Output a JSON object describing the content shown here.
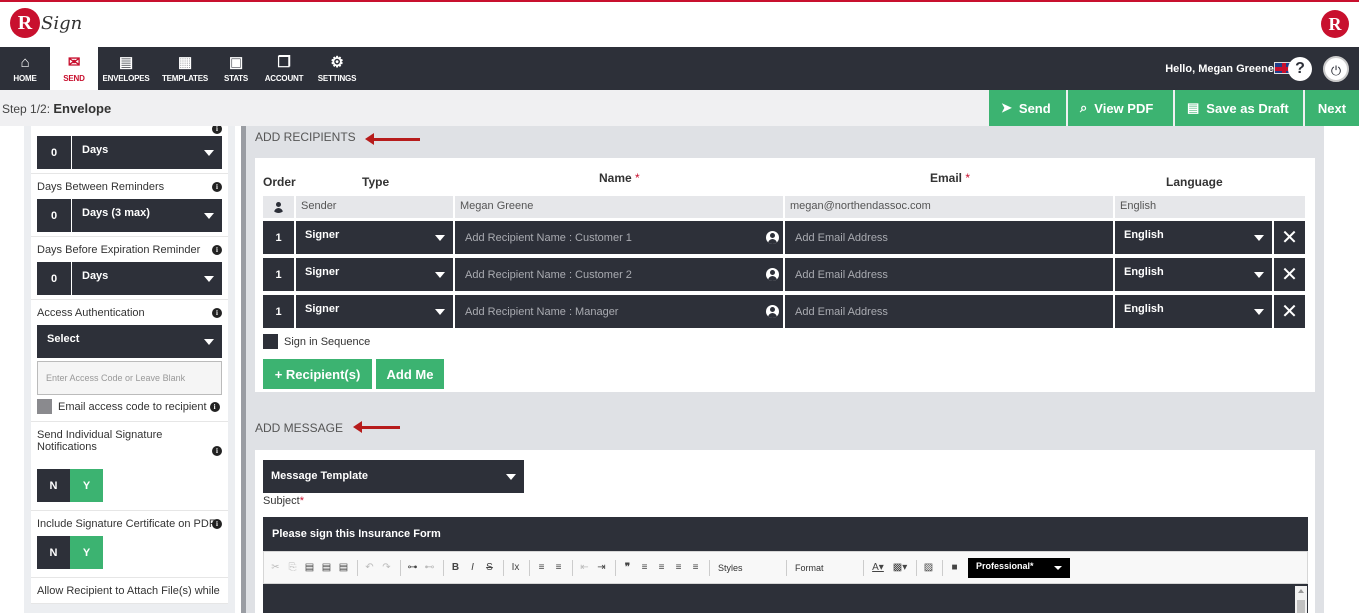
{
  "brand": {
    "logo_letter": "R",
    "logo_word": "Sign",
    "right_logo_letter": "R"
  },
  "nav": {
    "items": [
      {
        "label": "HOME",
        "icon": "home-icon"
      },
      {
        "label": "SEND",
        "icon": "envelope-icon"
      },
      {
        "label": "ENVELOPES",
        "icon": "inbox-icon"
      },
      {
        "label": "TEMPLATES",
        "icon": "document-icon"
      },
      {
        "label": "STATS",
        "icon": "briefcase-icon"
      },
      {
        "label": "ACCOUNT",
        "icon": "files-icon"
      },
      {
        "label": "SETTINGS",
        "icon": "gear-icon"
      }
    ],
    "active": "SEND",
    "greeting": "Hello, Megan Greene",
    "help_glyph": "?",
    "power_glyph": "⏻"
  },
  "step": {
    "prefix": "Step 1/2:",
    "name": "Envelope"
  },
  "actions": {
    "send": "Send",
    "view_pdf": "View PDF",
    "save_draft": "Save as Draft",
    "next": "Next"
  },
  "sidebar": {
    "top_dd": {
      "num": "0",
      "value": "Days"
    },
    "reminders": {
      "label": "Days Between Reminders",
      "num": "0",
      "value": "Days (3 max)"
    },
    "expiration": {
      "label": "Days Before Expiration Reminder",
      "num": "0",
      "value": "Days"
    },
    "access": {
      "label": "Access Authentication",
      "value": "Select",
      "placeholder": "Enter Access Code or Leave Blank",
      "email_code": "Email access code to recipient"
    },
    "individual": {
      "label": "Send Individual Signature Notifications",
      "n": "N",
      "y": "Y"
    },
    "certificate": {
      "label": "Include Signature Certificate on PDF",
      "n": "N",
      "y": "Y"
    },
    "attach": {
      "label": "Allow Recipient to Attach File(s) while"
    }
  },
  "recipients": {
    "section_title": "ADD RECIPIENTS",
    "headers": {
      "order": "Order",
      "type": "Type",
      "name": "Name",
      "email": "Email",
      "language": "Language",
      "required": "*"
    },
    "sender": {
      "type": "Sender",
      "name": "Megan Greene",
      "email": "megan@northendassoc.com",
      "language": "English"
    },
    "rows": [
      {
        "order": "1",
        "type": "Signer",
        "name_placeholder": "Add Recipient Name : Customer 1",
        "email_placeholder": "Add Email Address",
        "language": "English"
      },
      {
        "order": "1",
        "type": "Signer",
        "name_placeholder": "Add Recipient Name : Customer 2",
        "email_placeholder": "Add Email Address",
        "language": "English"
      },
      {
        "order": "1",
        "type": "Signer",
        "name_placeholder": "Add Recipient Name : Manager",
        "email_placeholder": "Add Email Address",
        "language": "English"
      }
    ],
    "sign_in_sequence": "Sign in Sequence",
    "add_recipient_btn": "+ Recipient(s)",
    "add_me_btn": "Add Me"
  },
  "message": {
    "section_title": "ADD MESSAGE",
    "template_dd": "Message Template",
    "subject_label": "Subject",
    "required": "*",
    "subject_value": "Please sign this Insurance Form",
    "toolbar": {
      "styles": "Styles",
      "format": "Format",
      "font": "Professional*"
    }
  },
  "colors": {
    "accent_red": "#c8102e",
    "dark": "#2d3039",
    "green": "#3cb371"
  }
}
